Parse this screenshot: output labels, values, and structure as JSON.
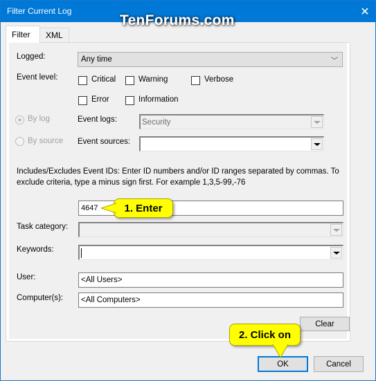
{
  "window": {
    "title": "Filter Current Log",
    "close_icon": "close-icon",
    "watermark": "TenForums.com"
  },
  "tabs": [
    {
      "label": "Filter",
      "active": true
    },
    {
      "label": "XML",
      "active": false
    }
  ],
  "filter": {
    "logged_label": "Logged:",
    "logged_value": "Any time",
    "event_level_label": "Event level:",
    "levels": [
      {
        "label": "Critical",
        "checked": false
      },
      {
        "label": "Warning",
        "checked": false
      },
      {
        "label": "Verbose",
        "checked": false
      },
      {
        "label": "Error",
        "checked": false
      },
      {
        "label": "Information",
        "checked": false
      }
    ],
    "by_log_label": "By log",
    "by_source_label": "By source",
    "by_log_selected": true,
    "event_logs_label": "Event logs:",
    "event_logs_value": "Security",
    "event_sources_label": "Event sources:",
    "event_sources_value": "",
    "event_ids_description": "Includes/Excludes Event IDs: Enter ID numbers and/or ID ranges separated by commas. To exclude criteria, type a minus sign first. For example 1,3,5-99,-76",
    "event_ids_value": "4647",
    "task_category_label": "Task category:",
    "task_category_value": "",
    "keywords_label": "Keywords:",
    "keywords_value": "",
    "user_label": "User:",
    "user_value": "<All Users>",
    "computers_label": "Computer(s):",
    "computers_value": "<All Computers>",
    "clear_label": "Clear"
  },
  "footer": {
    "ok_label": "OK",
    "cancel_label": "Cancel"
  },
  "annotations": {
    "step1": "1. Enter",
    "step2": "2. Click on",
    "callout_color": "#ffff00"
  },
  "colors": {
    "titlebar": "#0078d7",
    "dialog_bg": "#f0f0f0",
    "default_button_border": "#0078d7"
  }
}
